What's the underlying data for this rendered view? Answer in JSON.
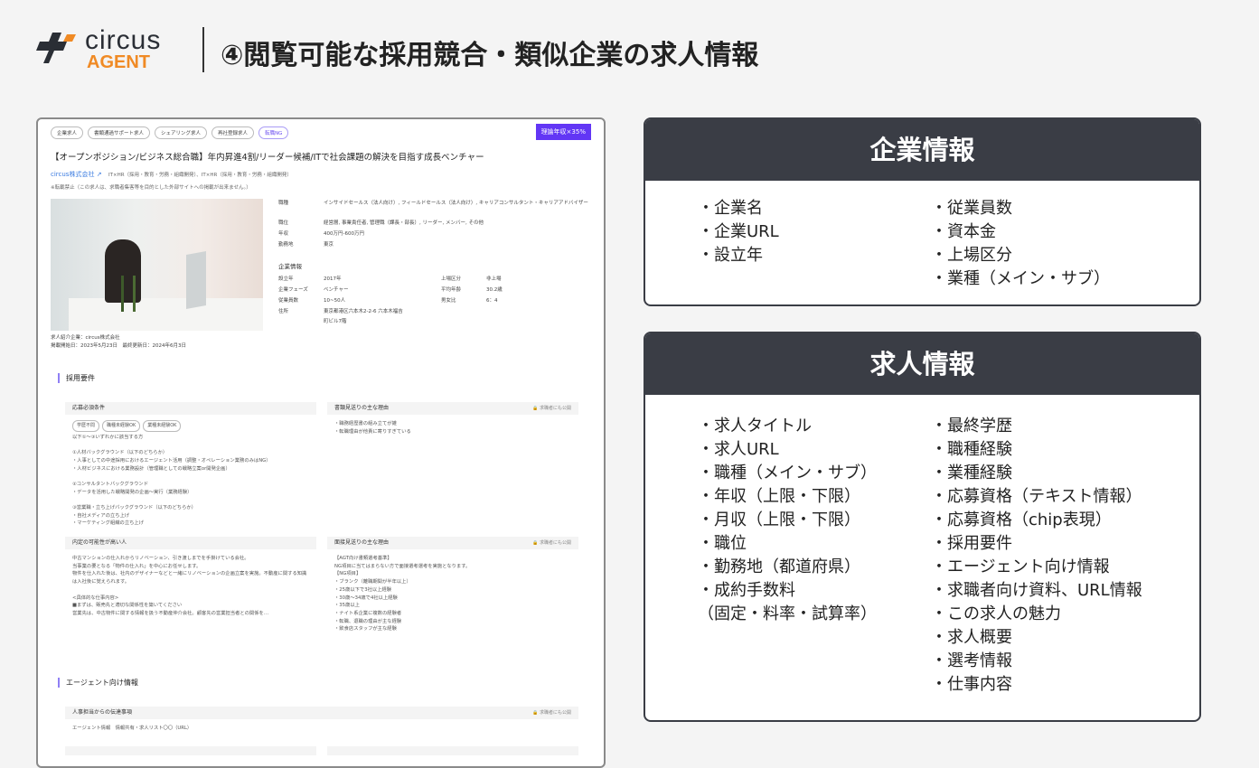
{
  "header": {
    "logo_word": "circus",
    "logo_sub": "AGENT",
    "title": "④閲覧可能な採用競合・類似企業の求人情報"
  },
  "job": {
    "chips": [
      "企業求人",
      "書類通過サポート求人",
      "シェアリング求人",
      "再社登録求人",
      "転職NG"
    ],
    "salary_badge": "理論年収×35%",
    "title": "【オープンポジション/ビジネス総合職】年内昇進4割/リーダー候補/ITで社会課題の解決を目指す成長ベンチャー",
    "company": "circus株式会社",
    "industry": "IT×HR（採用・教育・労務・組織開発）、IT×HR（採用・教育・労務・組織開発）",
    "notice": "※転載禁止（この求人は、求職者集客等を目的とした外部サイトへの掲載が出来ません。）",
    "details": [
      {
        "k": "職種",
        "v": "インサイドセールス（法人向け）, フィールドセールス（法人向け）, キャリアコンサルタント・キャリアアドバイザー"
      },
      {
        "k": "職位",
        "v": "経営層, 事業責任者, 管理職（課長・部長）, リーダー, メンバー, その他"
      },
      {
        "k": "年収",
        "v": "400万円-600万円"
      },
      {
        "k": "勤務地",
        "v": "東京"
      }
    ],
    "company_info_label": "企業情報",
    "company_info": [
      {
        "k": "設立年",
        "v": "2017年"
      },
      {
        "k": "企業フェーズ",
        "v": "ベンチャー"
      },
      {
        "k": "従業員数",
        "v": "10~50人"
      },
      {
        "k": "住所",
        "v": "東京都港区六本木2-2-6 六本木福吉町ビル7階"
      },
      {
        "k": "上場区分",
        "v": "非上場"
      },
      {
        "k": "平均年齢",
        "v": "30.2歳"
      },
      {
        "k": "男女比",
        "v": "6：4"
      }
    ],
    "meta": [
      "求人紹介企業：circus株式会社",
      "掲載開始日：2023年5月23日　最終更新日：2024年6月3日"
    ],
    "section1": "採用要件",
    "boxes": [
      {
        "title": "応募必須条件",
        "pub": "",
        "chips": [
          "学歴不問",
          "職種未経験OK",
          "業種未経験OK"
        ],
        "body": "以下①～③いずれかに該当する方\n\n①人材バックグラウンド（以下のどちらか）\n・人事としての中途採用におけるエージェント活用（調整・オペレーション業務のみはNG）\n・人材ビジネスにおける業務設計（管理職としての戦略立案or開発企画）\n\n②コンサルタントバックグラウンド\n・データを活用した戦略開発の企画～実行（業務経験）\n\n③営業職・立ち上げバックグラウンド（以下のどちらか）\n・自社メディアの立ち上げ\n・マーケティング組織の立ち上げ"
      },
      {
        "title": "書類見送りの主な理由",
        "pub": "求職者にも公開",
        "chips": [],
        "body": "・職務経歴書の組み立てが雑\n・転職理由が他責に寄りすぎている"
      },
      {
        "title": "内定の可能性が高い人",
        "pub": "",
        "chips": [],
        "body": "中古マンションの仕入れからリノベーション、引き渡しまでを手掛けている会社。\n当事業の要となる「物件の仕入れ」を中心にお任せします。\n物件を仕入れた後は、社内のデザイナーなどと一緒にリノベーションの企画立案を実施。不動産に関する知識は入社後に覚えられます。\n\n<具体的な仕事内容>\n■まずは、販売先と適切な関係性を築いてください\n営業先は、中古物件に関する情報を扱う不動産仲介会社。顧客先の営業担当者との関係を…"
      },
      {
        "title": "面接見送りの主な理由",
        "pub": "求職者にも公開",
        "chips": [],
        "body": "【AGT向け書類選考基準】\nNG項目に当てはまらない方で面接選考選考を実施となります。\n【NG項目】\n・ブランク（離職期間が半年以上）\n・25歳以下で3社以上経験\n・30歳～34歳で4社以上経験\n・35歳以上\n・ナイト系企業に複数の経験者\n・転職、退職の理由が主な経験\n・飲食店スタッフが主な経験"
      }
    ],
    "section2": "エージェント向け情報",
    "agent_box": {
      "title": "人事担当からの伝達事項",
      "pub": "求職者にも公開",
      "body": "エージェント情報　情報共有・求人リスト〇〇（URL）"
    }
  },
  "company_card": {
    "title": "企業情報",
    "left": [
      "・企業名",
      "・企業URL",
      "・設立年"
    ],
    "right": [
      "・従業員数",
      "・資本金",
      "・上場区分",
      "・業種（メイン・サブ）"
    ]
  },
  "job_card": {
    "title": "求人情報",
    "left": [
      "・求人タイトル",
      "・求人URL",
      "・職種（メイン・サブ）",
      "・年収（上限・下限）",
      "・月収（上限・下限）",
      "・職位",
      "・勤務地（都道府県）",
      "・成約手数料",
      "（固定・料率・試算率）"
    ],
    "right": [
      "・最終学歴",
      "・職種経験",
      "・業種経験",
      "・応募資格（テキスト情報）",
      "・応募資格（chip表現）",
      "・採用要件",
      "・エージェント向け情報",
      "・求職者向け資料、URL情報",
      "・この求人の魅力",
      "・求人概要",
      "・選考情報",
      "・仕事内容"
    ]
  }
}
